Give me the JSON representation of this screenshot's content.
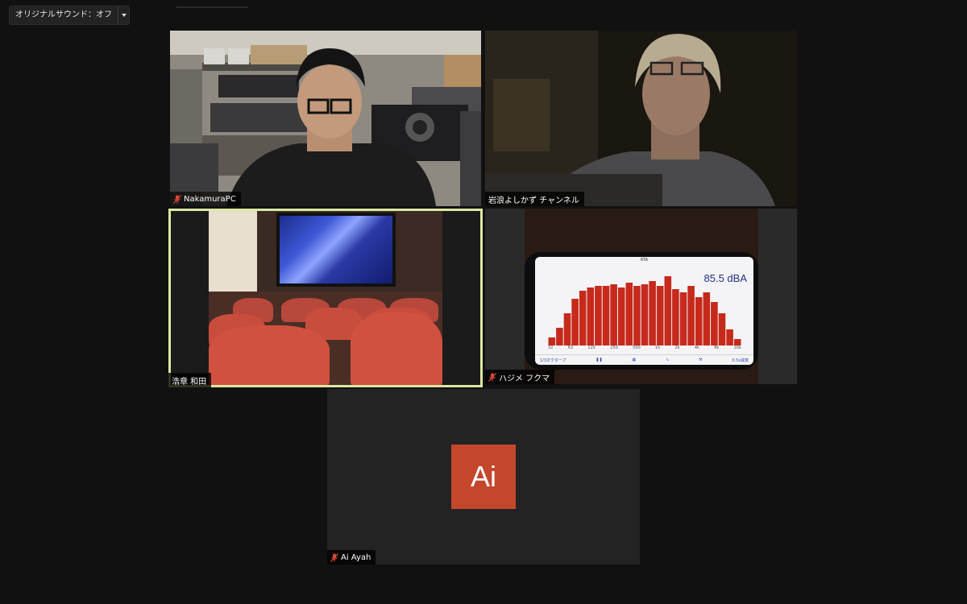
{
  "toolbar": {
    "original_sound_label": "オリジナルサウンド：オフ"
  },
  "participants": [
    {
      "name": "NakamuraPC",
      "muted": true,
      "video": true
    },
    {
      "name": "岩浪よしかず チャンネル",
      "muted": false,
      "video": true
    },
    {
      "name": "浩章 和田",
      "muted": false,
      "video": true,
      "active_speaker": true
    },
    {
      "name": "ハジメ フクマ",
      "muted": true,
      "video": true
    },
    {
      "name": "Ai Ayah",
      "muted": true,
      "video": false,
      "avatar_initials": "Ai",
      "avatar_color": "#c4472c"
    }
  ],
  "rta_app": {
    "title": "RTA",
    "level": "85.5 dBA",
    "band_mode": "1/3オクターブ",
    "response": "0.5s減衰",
    "x_ticks": [
      "32",
      "63",
      "125",
      "250",
      "500",
      "1k",
      "2k",
      "4k",
      "8k",
      "16k"
    ]
  },
  "colors": {
    "active_border": "#d9e8a1",
    "mute_icon": "#e0483a",
    "background": "#111111"
  }
}
